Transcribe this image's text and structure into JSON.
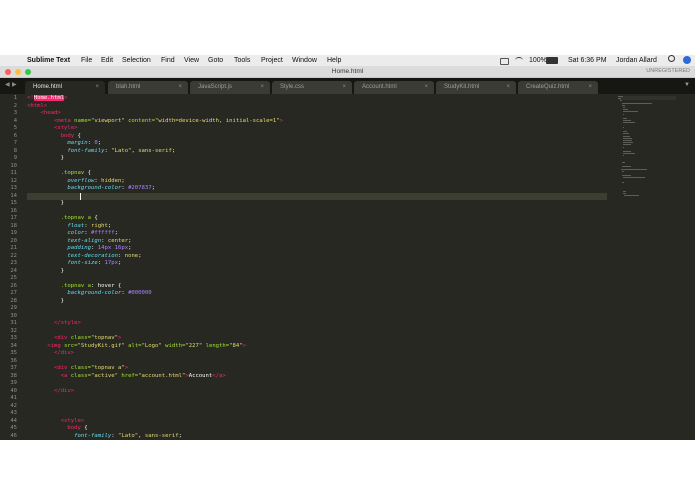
{
  "menubar": {
    "app_name": "Sublime Text",
    "items": [
      "File",
      "Edit",
      "Selection",
      "Find",
      "View",
      "Goto",
      "Tools",
      "Project",
      "Window",
      "Help"
    ],
    "battery": "100%",
    "clock": "Sat 6:36 PM",
    "user": "Jordan Allard"
  },
  "window": {
    "title": "Home.html",
    "unregistered": "UNREGISTERED"
  },
  "tabs": [
    {
      "label": "Home.html",
      "active": true
    },
    {
      "label": "blah.html",
      "active": false
    },
    {
      "label": "JavaScript.js",
      "active": false
    },
    {
      "label": "Style.css",
      "active": false
    },
    {
      "label": "Account.html",
      "active": false
    },
    {
      "label": "StudyKit.html",
      "active": false
    },
    {
      "label": "CreateQuiz.html",
      "active": false
    }
  ],
  "editor": {
    "active_line": 14,
    "lines": [
      [
        [
          "tag",
          "<!"
        ],
        [
          "hl",
          "Home.html"
        ],
        [
          "tag",
          ">"
        ]
      ],
      [
        [
          "tag",
          "<html>"
        ]
      ],
      [
        [
          "pun",
          "    "
        ],
        [
          "tag",
          "<head>"
        ]
      ],
      [
        [
          "pun",
          "        "
        ],
        [
          "tag",
          "<meta "
        ],
        [
          "attr",
          "name="
        ],
        [
          "str",
          "\"viewport\" "
        ],
        [
          "attr",
          "content="
        ],
        [
          "str",
          "\"width=device-width, initial-scale=1\""
        ],
        [
          "tag",
          ">"
        ]
      ],
      [
        [
          "pun",
          "        "
        ],
        [
          "tag",
          "<style>"
        ]
      ],
      [
        [
          "pun",
          "          "
        ],
        [
          "tag",
          "body "
        ],
        [
          "pun",
          "{"
        ]
      ],
      [
        [
          "pun",
          "            "
        ],
        [
          "prop",
          "margin"
        ],
        [
          "pun",
          ": "
        ],
        [
          "num",
          "0"
        ],
        [
          "pun",
          ";"
        ]
      ],
      [
        [
          "pun",
          "            "
        ],
        [
          "prop",
          "font-family"
        ],
        [
          "pun",
          ": "
        ],
        [
          "str",
          "\"Lato\""
        ],
        [
          "pun",
          ", "
        ],
        [
          "str",
          "sans-serif"
        ],
        [
          "pun",
          ";"
        ]
      ],
      [
        [
          "pun",
          "          }"
        ]
      ],
      [
        [
          "pun",
          ""
        ]
      ],
      [
        [
          "pun",
          "          "
        ],
        [
          "sel",
          ".topnav "
        ],
        [
          "pun",
          "{"
        ]
      ],
      [
        [
          "pun",
          "            "
        ],
        [
          "prop",
          "overflow"
        ],
        [
          "pun",
          ": "
        ],
        [
          "str",
          "hidden"
        ],
        [
          "pun",
          ";"
        ]
      ],
      [
        [
          "pun",
          "            "
        ],
        [
          "prop",
          "background-color"
        ],
        [
          "pun",
          ": "
        ],
        [
          "num",
          "#207837"
        ],
        [
          "pun",
          ";"
        ]
      ],
      [
        [
          "pun",
          "          "
        ]
      ],
      [
        [
          "pun",
          "          }"
        ]
      ],
      [
        [
          "pun",
          ""
        ]
      ],
      [
        [
          "pun",
          "          "
        ],
        [
          "sel",
          ".topnav a "
        ],
        [
          "pun",
          "{"
        ]
      ],
      [
        [
          "pun",
          "            "
        ],
        [
          "prop",
          "float"
        ],
        [
          "pun",
          ": "
        ],
        [
          "str",
          "right"
        ],
        [
          "pun",
          ";"
        ]
      ],
      [
        [
          "pun",
          "            "
        ],
        [
          "prop",
          "color"
        ],
        [
          "pun",
          ": "
        ],
        [
          "num",
          "#ffffff"
        ],
        [
          "pun",
          ";"
        ]
      ],
      [
        [
          "pun",
          "            "
        ],
        [
          "prop",
          "text-align"
        ],
        [
          "pun",
          ": "
        ],
        [
          "str",
          "center"
        ],
        [
          "pun",
          ";"
        ]
      ],
      [
        [
          "pun",
          "            "
        ],
        [
          "prop",
          "padding"
        ],
        [
          "pun",
          ": "
        ],
        [
          "num",
          "14px 16px"
        ],
        [
          "pun",
          ";"
        ]
      ],
      [
        [
          "pun",
          "            "
        ],
        [
          "prop",
          "text-decoration"
        ],
        [
          "pun",
          ": "
        ],
        [
          "str",
          "none"
        ],
        [
          "pun",
          ";"
        ]
      ],
      [
        [
          "pun",
          "            "
        ],
        [
          "prop",
          "font-size"
        ],
        [
          "pun",
          ": "
        ],
        [
          "num",
          "17px"
        ],
        [
          "pun",
          ";"
        ]
      ],
      [
        [
          "pun",
          "          }"
        ]
      ],
      [
        [
          "pun",
          ""
        ]
      ],
      [
        [
          "pun",
          "          "
        ],
        [
          "sel",
          ".topnav a"
        ],
        [
          "pun",
          ": "
        ],
        [
          "pun",
          "hover {"
        ]
      ],
      [
        [
          "pun",
          "            "
        ],
        [
          "prop",
          "background-color"
        ],
        [
          "pun",
          ": "
        ],
        [
          "num",
          "#000000"
        ]
      ],
      [
        [
          "pun",
          "          }"
        ]
      ],
      [
        [
          "pun",
          ""
        ]
      ],
      [
        [
          "pun",
          ""
        ]
      ],
      [
        [
          "pun",
          "        "
        ],
        [
          "tag",
          "</style>"
        ]
      ],
      [
        [
          "pun",
          ""
        ]
      ],
      [
        [
          "pun",
          "        "
        ],
        [
          "tag",
          "<div "
        ],
        [
          "attr",
          "class="
        ],
        [
          "str",
          "\"topnav\""
        ],
        [
          "tag",
          ">"
        ]
      ],
      [
        [
          "pun",
          "      "
        ],
        [
          "tag",
          "<img "
        ],
        [
          "attr",
          "src="
        ],
        [
          "str",
          "\"StudyKit.gif\" "
        ],
        [
          "attr",
          "alt="
        ],
        [
          "str",
          "\"Logo\" "
        ],
        [
          "attr",
          "width="
        ],
        [
          "str",
          "\"227\" "
        ],
        [
          "attr",
          "length="
        ],
        [
          "str",
          "\"84\""
        ],
        [
          "tag",
          ">"
        ]
      ],
      [
        [
          "pun",
          "        "
        ],
        [
          "tag",
          "</div>"
        ]
      ],
      [
        [
          "pun",
          ""
        ]
      ],
      [
        [
          "pun",
          "        "
        ],
        [
          "tag",
          "<div "
        ],
        [
          "attr",
          "class="
        ],
        [
          "str",
          "\"topnav a\""
        ],
        [
          "tag",
          ">"
        ]
      ],
      [
        [
          "pun",
          "          "
        ],
        [
          "tag",
          "<a "
        ],
        [
          "attr",
          "class="
        ],
        [
          "str",
          "\"active\" "
        ],
        [
          "attr",
          "href="
        ],
        [
          "str",
          "\"account.html\""
        ],
        [
          "tag",
          ">"
        ],
        [
          "pun",
          "Account"
        ],
        [
          "tag",
          "</a>"
        ]
      ],
      [
        [
          "pun",
          ""
        ]
      ],
      [
        [
          "pun",
          "        "
        ],
        [
          "tag",
          "</div>"
        ]
      ],
      [
        [
          "pun",
          ""
        ]
      ],
      [
        [
          "pun",
          ""
        ]
      ],
      [
        [
          "pun",
          ""
        ]
      ],
      [
        [
          "pun",
          "          "
        ],
        [
          "tag",
          "<style>"
        ]
      ],
      [
        [
          "pun",
          "            "
        ],
        [
          "tag",
          "body "
        ],
        [
          "pun",
          "{"
        ]
      ],
      [
        [
          "pun",
          "              "
        ],
        [
          "prop",
          "font-family"
        ],
        [
          "pun",
          ": "
        ],
        [
          "str",
          "\"Lato\""
        ],
        [
          "pun",
          ", "
        ],
        [
          "str",
          "sans-serif"
        ],
        [
          "pun",
          ";"
        ]
      ]
    ]
  },
  "colors": {
    "editor_bg": "#272822",
    "tag": "#f92672",
    "string": "#e6db74",
    "property": "#66d9ef",
    "number": "#ae81ff",
    "selector": "#a6e22e"
  }
}
